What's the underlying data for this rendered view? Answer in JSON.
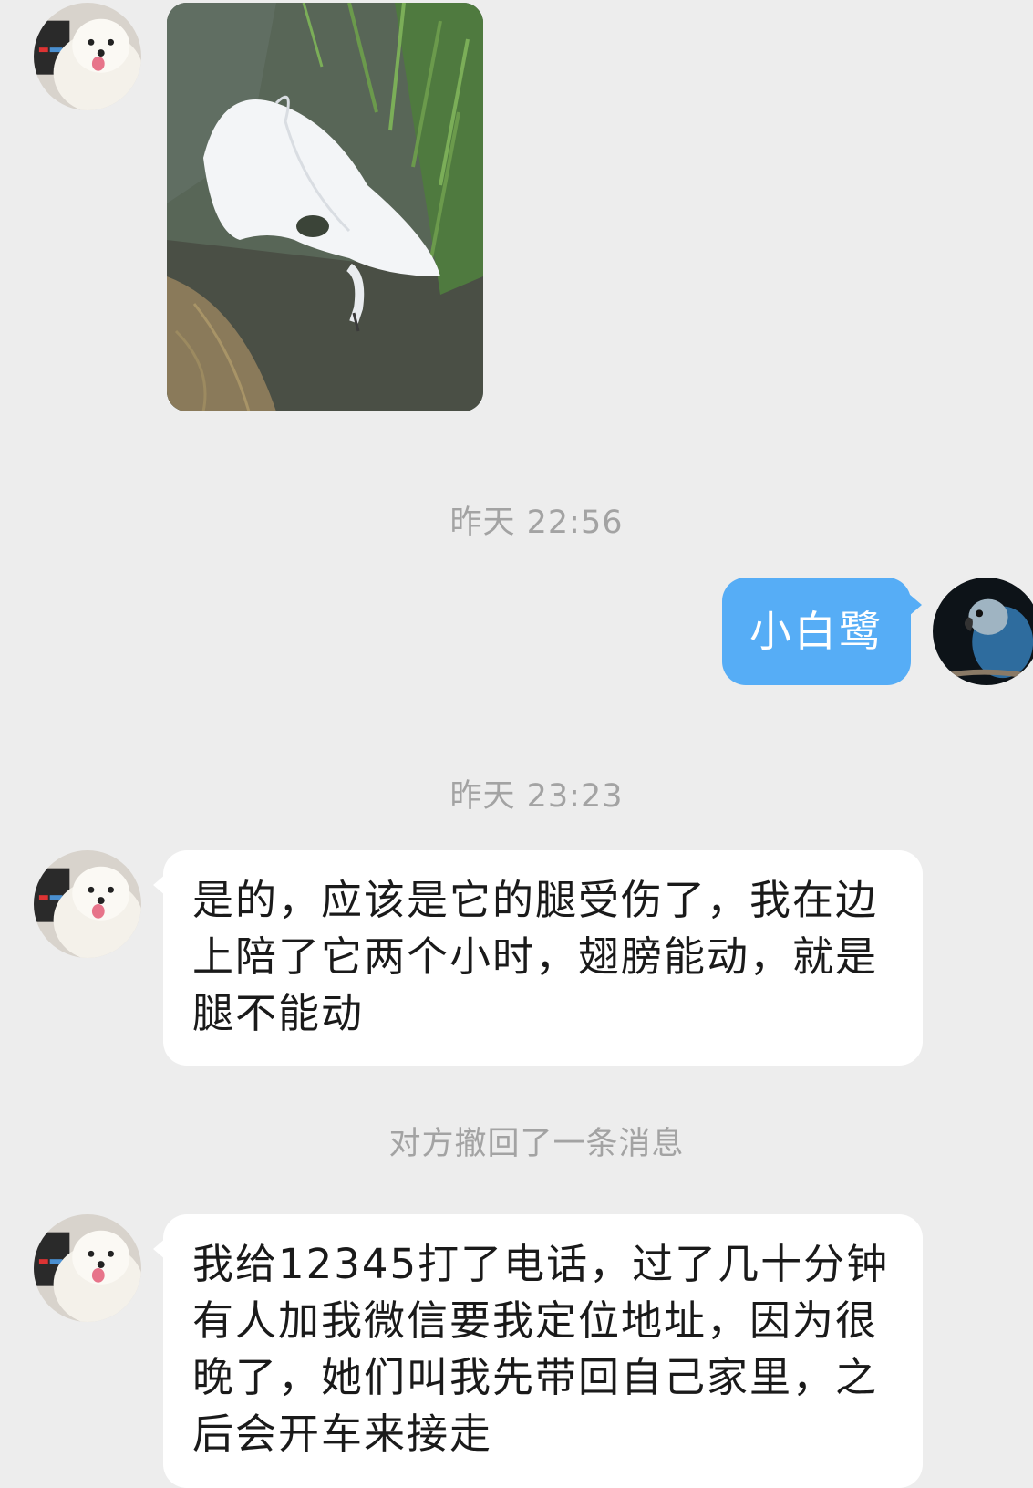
{
  "conversation": {
    "messages": [
      {
        "type": "image",
        "sender": "other",
        "content": "white-egret-photo"
      },
      {
        "type": "timestamp",
        "text": "昨天 22:56"
      },
      {
        "type": "text",
        "sender": "me",
        "text": "小白鹭"
      },
      {
        "type": "timestamp",
        "text": "昨天 23:23"
      },
      {
        "type": "text",
        "sender": "other",
        "text": "是的，应该是它的腿受伤了，我在边上陪了它两个小时，翅膀能动，就是腿不能动"
      },
      {
        "type": "system",
        "text": "对方撤回了一条消息"
      },
      {
        "type": "text",
        "sender": "other",
        "text": "我给12345打了电话，过了几十分钟有人加我微信要我定位地址，因为很晚了，她们叫我先带回自己家里，之后会开车来接走"
      }
    ]
  },
  "colors": {
    "background": "#ededed",
    "bubble_other": "#ffffff",
    "bubble_me": "#56adf6",
    "meta_text": "#a3a3a3"
  },
  "avatars": {
    "other": "samoyed-dog-avatar-icon",
    "me": "blue-parrot-avatar-icon"
  }
}
